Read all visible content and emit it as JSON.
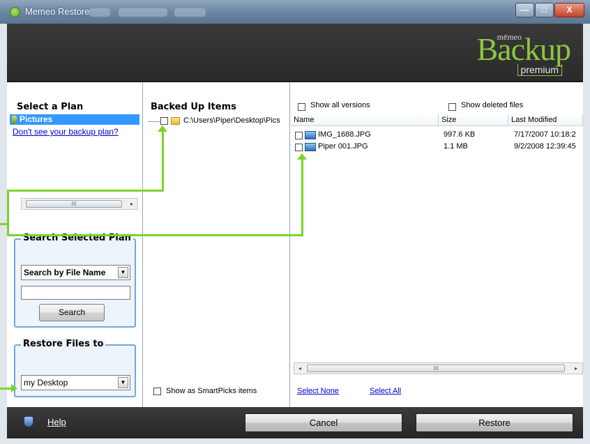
{
  "window": {
    "title": "Memeo Restore",
    "minimize_glyph": "—",
    "maximize_glyph": "□",
    "close_glyph": "X"
  },
  "logo": {
    "brand_small": "mēmeo",
    "brand_main": "Backup",
    "edition": "premium",
    "accent_color": "#8dc63f"
  },
  "plan_panel": {
    "title": "Select a Plan",
    "selected_plan": "Pictures",
    "help_link": "Don't see your backup plan?",
    "scroll_thumb_glyph": "III",
    "scroll_right_glyph": "▸"
  },
  "search_group": {
    "title": "Search Selected Plan",
    "search_type": "Search by File Name",
    "dropdown_glyph": "▼",
    "search_input_value": "",
    "search_button": "Search"
  },
  "restore_group": {
    "title": "Restore Files to",
    "destination": "my Desktop",
    "dropdown_glyph": "▼"
  },
  "backed_up": {
    "title": "Backed Up Items",
    "tree_item": "C:\\Users\\Piper\\Desktop\\Pics",
    "smartpicks_label": "Show as SmartPicks items"
  },
  "files": {
    "show_all_versions": "Show all versions",
    "show_deleted_files": "Show deleted files",
    "columns": [
      "Name",
      "Size",
      "Last Modified"
    ],
    "rows": [
      {
        "name": "IMG_1688.JPG",
        "size": "997.6 KB",
        "modified": "7/17/2007 10:18:2"
      },
      {
        "name": "Piper 001.JPG",
        "size": "1.1 MB",
        "modified": "9/2/2008 12:39:45"
      }
    ],
    "scroll_left_glyph": "◂",
    "scroll_thumb_glyph": "III",
    "scroll_right_glyph": "▸",
    "select_none": "Select None",
    "select_all": "Select All"
  },
  "footer": {
    "help": "Help",
    "cancel": "Cancel",
    "restore": "Restore"
  },
  "colors": {
    "callout_green": "#7dd32a",
    "selection_blue": "#3399ff",
    "link_blue": "#0000cc"
  }
}
